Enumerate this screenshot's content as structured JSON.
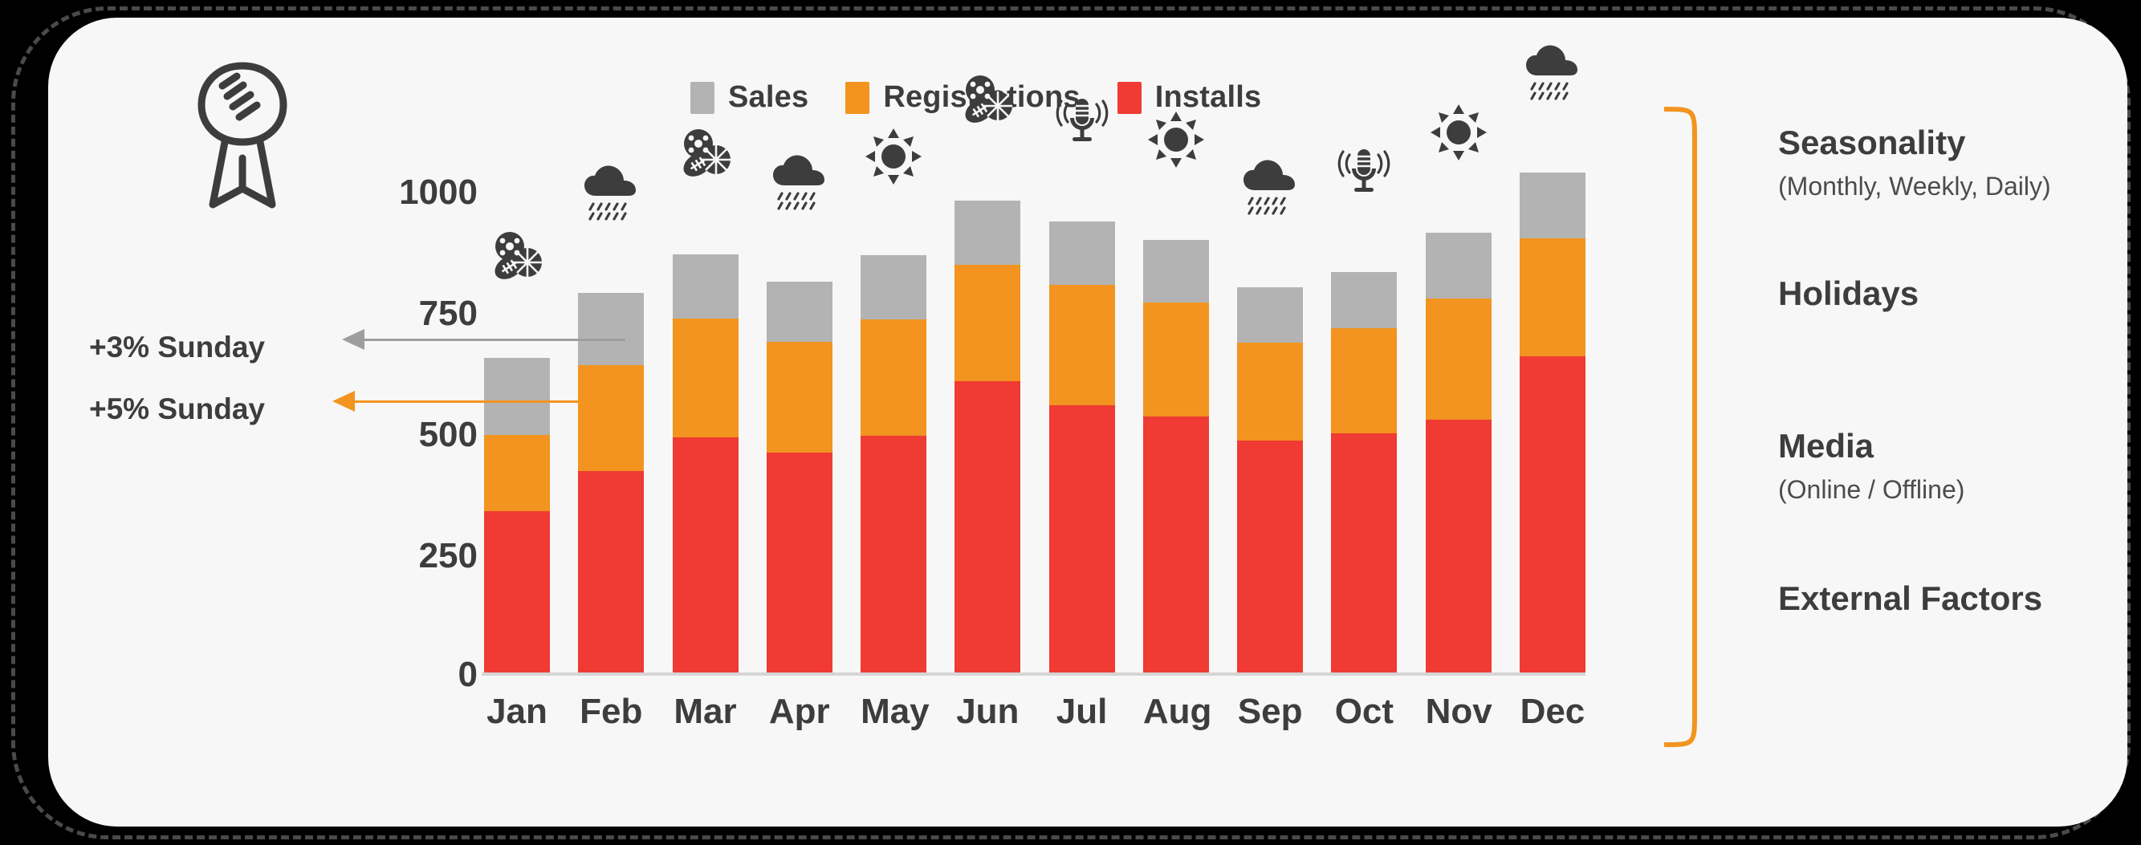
{
  "colors": {
    "sales": "#b3b3b3",
    "registrations": "#f2941f",
    "installs": "#ef3b33",
    "accent_orange": "#f2941f",
    "text": "#3d3d3d",
    "card_bg": "#f7f7f7",
    "page_bg": "#000000",
    "axis": "#d5d5d5"
  },
  "legend": {
    "items": [
      {
        "label": "Sales",
        "color": "#b3b3b3",
        "key": "sales"
      },
      {
        "label": "Registrations",
        "color": "#f2941f",
        "key": "registrations"
      },
      {
        "label": "Installs",
        "color": "#ef3b33",
        "key": "installs"
      }
    ]
  },
  "annotations": [
    {
      "label": "+3% Sunday",
      "color": "#9e9e9e",
      "target_month": "Feb",
      "target_series": "Sales"
    },
    {
      "label": "+5% Sunday",
      "color": "#f2941f",
      "target_month": "Feb",
      "target_series": "Registrations"
    }
  ],
  "right_panel": {
    "items": [
      {
        "title": "Seasonality",
        "subtitle": "(Monthly, Weekly, Daily)"
      },
      {
        "title": "Holidays",
        "subtitle": ""
      },
      {
        "title": "Media",
        "subtitle": "(Online / Offline)"
      },
      {
        "title": "External Factors",
        "subtitle": ""
      }
    ]
  },
  "icons": {
    "logo": "football-icon",
    "month_icons": [
      "sports-balls-icon",
      "rain-cloud-icon",
      "sports-balls-icon",
      "rain-cloud-icon",
      "sun-icon",
      "sports-balls-icon",
      "radio-microphone-icon",
      "sun-icon",
      "rain-cloud-icon",
      "radio-microphone-icon",
      "sun-icon",
      "rain-cloud-icon"
    ]
  },
  "chart_data": {
    "type": "bar",
    "stacked": true,
    "title": "",
    "xlabel": "",
    "ylabel": "",
    "ylim": [
      0,
      1050
    ],
    "yticks": [
      0,
      250,
      500,
      750,
      1000
    ],
    "ytick_labels": [
      "0",
      "250",
      "500",
      "750",
      "1000"
    ],
    "grid": false,
    "legend_position": "top",
    "categories": [
      "Jan",
      "Feb",
      "Mar",
      "Apr",
      "May",
      "Jun",
      "Jul",
      "Aug",
      "Sep",
      "Oct",
      "Nov",
      "Dec"
    ],
    "series": [
      {
        "name": "Installs",
        "color": "#ef3b33",
        "values": [
          333,
          416,
          485,
          454,
          489,
          601,
          551,
          528,
          478,
          493,
          521,
          652
        ]
      },
      {
        "name": "Registrations",
        "color": "#f2941f",
        "values": [
          157,
          219,
          245,
          229,
          240,
          240,
          248,
          235,
          202,
          217,
          250,
          243
        ]
      },
      {
        "name": "Sales",
        "color": "#b3b3b3",
        "values": [
          159,
          149,
          132,
          124,
          132,
          132,
          131,
          129,
          114,
          116,
          136,
          136
        ]
      }
    ],
    "totals": [
      649,
      784,
      862,
      807,
      861,
      973,
      930,
      892,
      794,
      826,
      907,
      1031
    ],
    "annotations": [
      {
        "text": "+3% Sunday",
        "points_to": {
          "month": "Feb",
          "value": 725
        }
      },
      {
        "text": "+5% Sunday",
        "points_to": {
          "month": "Feb",
          "value": 600
        }
      }
    ]
  }
}
